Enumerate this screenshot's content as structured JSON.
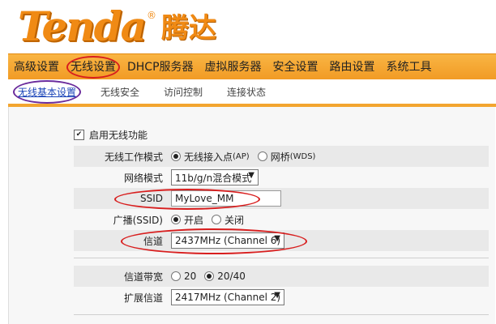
{
  "brand": {
    "name_en": "Tenda",
    "reg": "®",
    "name_cn": "腾达"
  },
  "menu": {
    "items": [
      {
        "label": "高级设置"
      },
      {
        "label": "无线设置",
        "active": true
      },
      {
        "label": "DHCP服务器"
      },
      {
        "label": "虚拟服务器"
      },
      {
        "label": "安全设置"
      },
      {
        "label": "路由设置"
      },
      {
        "label": "系统工具"
      }
    ]
  },
  "submenu": {
    "items": [
      {
        "label": "无线基本设置",
        "active": true
      },
      {
        "label": "无线安全"
      },
      {
        "label": "访问控制"
      },
      {
        "label": "连接状态"
      }
    ]
  },
  "form": {
    "enable_wireless": {
      "label": "启用无线功能",
      "checked": true
    },
    "work_mode": {
      "label": "无线工作模式",
      "option1": "无线接入点",
      "option1_tag": "(AP)",
      "option2": "网桥",
      "option2_tag": "(WDS)",
      "selected": "option1"
    },
    "network_mode": {
      "label": "网络模式",
      "value": "11b/g/n混合模式"
    },
    "ssid": {
      "label": "SSID",
      "value": "MyLove_MM"
    },
    "broadcast": {
      "label": "广播(SSID)",
      "on": "开启",
      "off": "关闭",
      "selected": "on"
    },
    "channel": {
      "label": "信道",
      "value": "2437MHz (Channel 6)"
    },
    "bandwidth": {
      "label": "信道带宽",
      "opt20": "20",
      "opt2040": "20/40",
      "selected": "20/40"
    },
    "ext_channel": {
      "label": "扩展信道",
      "value": "2417MHz (Channel 2)"
    }
  },
  "colors": {
    "accent": "#f08a14",
    "menubar": "#f3a52f",
    "highlight_oval": "#d81e1e",
    "submenu_oval": "#6b2c9c"
  }
}
